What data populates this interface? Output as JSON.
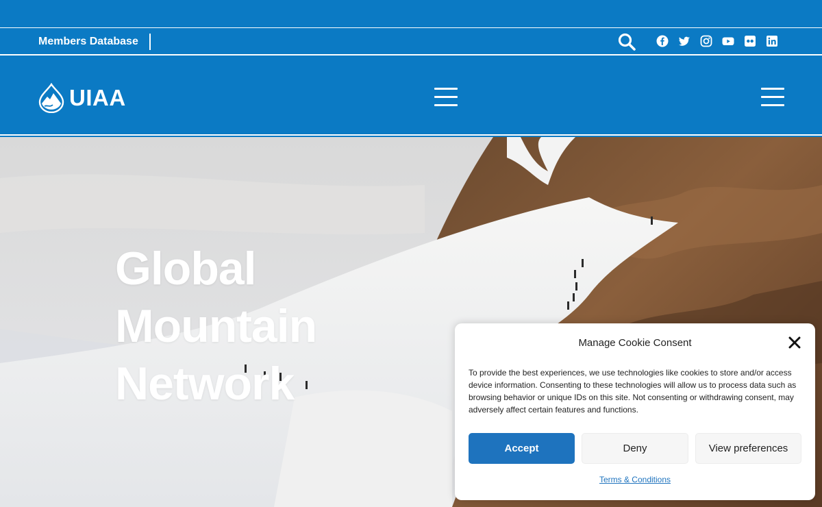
{
  "utility_bar": {
    "members_label": "Members Database",
    "social_icons": [
      "facebook-icon",
      "twitter-icon",
      "instagram-icon",
      "youtube-icon",
      "flickr-icon",
      "linkedin-icon"
    ]
  },
  "header": {
    "logo_text": "UIAA"
  },
  "hero": {
    "title_lines": [
      "Global",
      "Mountain",
      "Network"
    ]
  },
  "cookie_banner": {
    "title": "Manage Cookie Consent",
    "body": "To provide the best experiences, we use technologies like cookies to store and/or access device information. Consenting to these technologies will allow us to process data such as browsing behavior or unique IDs on this site. Not consenting or withdrawing consent, may adversely affect certain features and functions.",
    "accept_label": "Accept",
    "deny_label": "Deny",
    "preferences_label": "View preferences",
    "terms_label": "Terms & Conditions"
  },
  "colors": {
    "brand_blue": "#0b7ac4",
    "button_blue": "#1e73be"
  }
}
